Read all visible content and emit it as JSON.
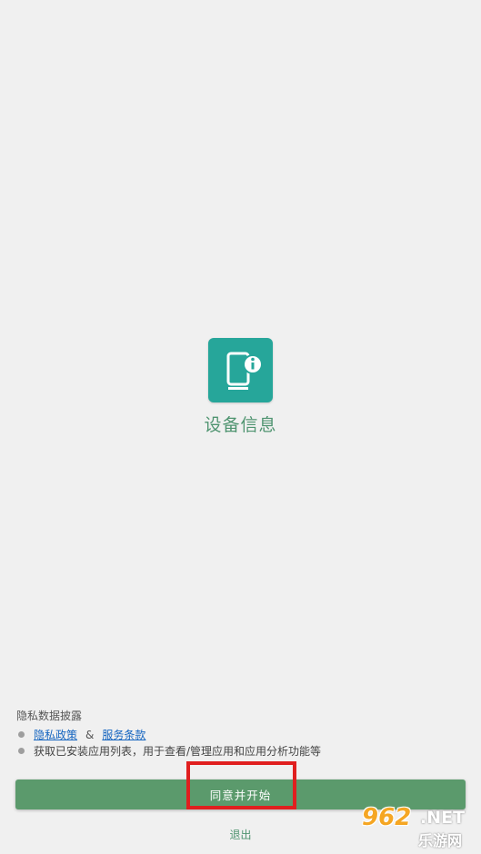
{
  "app": {
    "title": "设备信息",
    "icon": "phone-info-icon",
    "icon_color": "#26a69a",
    "accent_color": "#4f9470"
  },
  "privacy": {
    "title": "隐私数据披露",
    "privacy_policy_link": "隐私政策",
    "separator": "&",
    "terms_link": "服务条款",
    "permission_note": "获取已安装应用列表，用于查看/管理应用和应用分析功能等"
  },
  "actions": {
    "agree_label": "同意并开始",
    "agree_color": "#5b9a6c",
    "exit_label": "退出"
  },
  "watermark": {
    "number": "962",
    "domain": ".NET",
    "site_name": "乐游网"
  }
}
